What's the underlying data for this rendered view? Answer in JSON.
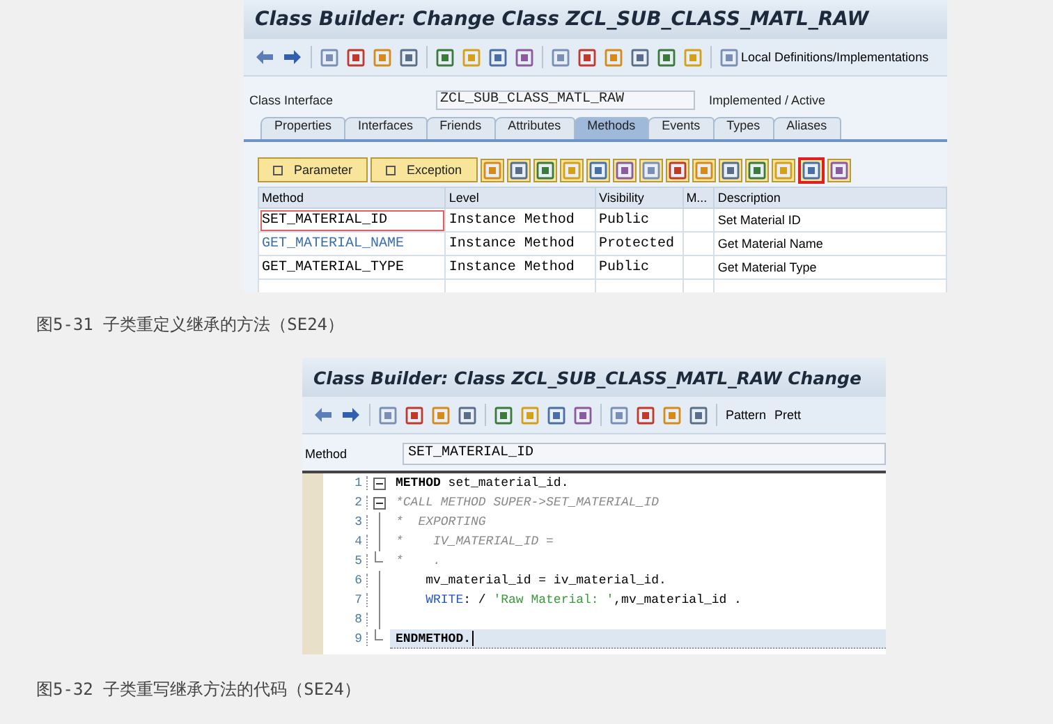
{
  "figures": [
    {
      "kind": "class_builder",
      "window_title": "Class Builder: Change Class ZCL_SUB_CLASS_MATL_RAW",
      "toolbar_link": "Local Definitions/Implementations",
      "class_interface": {
        "label": "Class Interface",
        "value": "ZCL_SUB_CLASS_MATL_RAW",
        "status": "Implemented / Active"
      },
      "tabs": [
        {
          "label": "Properties",
          "selected": false
        },
        {
          "label": "Interfaces",
          "selected": false
        },
        {
          "label": "Friends",
          "selected": false
        },
        {
          "label": "Attributes",
          "selected": false
        },
        {
          "label": "Methods",
          "selected": true
        },
        {
          "label": "Events",
          "selected": false
        },
        {
          "label": "Types",
          "selected": false
        },
        {
          "label": "Aliases",
          "selected": false
        }
      ],
      "method_buttons": [
        "Parameter",
        "Exception"
      ],
      "method_tools": [
        {
          "highlighted": false
        },
        {
          "highlighted": false
        },
        {
          "highlighted": false
        },
        {
          "highlighted": false
        },
        {
          "highlighted": false
        },
        {
          "highlighted": false
        },
        {
          "highlighted": false
        },
        {
          "highlighted": false
        },
        {
          "highlighted": false
        },
        {
          "highlighted": false
        },
        {
          "highlighted": false
        },
        {
          "highlighted": false
        },
        {
          "highlighted": true
        },
        {
          "highlighted": false
        }
      ],
      "columns": [
        "Method",
        "Level",
        "Visibility",
        "M...",
        "Description"
      ],
      "rows": [
        {
          "cells": [
            "SET_MATERIAL_ID",
            "Instance Method",
            "Public",
            "Set Material ID"
          ],
          "inherited": false,
          "focused": true
        },
        {
          "cells": [
            "GET_MATERIAL_NAME",
            "Instance Method",
            "Protected",
            "Get Material Name"
          ],
          "inherited": true,
          "focused": false
        },
        {
          "cells": [
            "GET_MATERIAL_TYPE",
            "Instance Method",
            "Public",
            "Get Material Type"
          ],
          "inherited": false,
          "focused": false
        }
      ],
      "caption": "图5-31 子类重定义继承的方法（SE24）"
    },
    {
      "kind": "code_editor",
      "window_title": "Class Builder: Class ZCL_SUB_CLASS_MATL_RAW Change",
      "toolbar_texts": [
        "Pattern",
        "Prett"
      ],
      "method_label": "Method",
      "method_value": "SET_MATERIAL_ID",
      "lines": [
        {
          "number": "1",
          "fold_toggle": true,
          "current": false,
          "segments": [
            {
              "text": "METHOD",
              "kind": "bold"
            },
            {
              "text": " set_material_id.",
              "kind": "plain"
            }
          ]
        },
        {
          "number": "2",
          "fold_toggle": true,
          "current": false,
          "segments": [
            {
              "text": "*CALL METHOD SUPER->SET_MATERIAL_ID",
              "kind": "comment"
            }
          ]
        },
        {
          "number": "3",
          "fold_toggle": false,
          "block_end": false,
          "current": false,
          "segments": [
            {
              "text": "*  EXPORTING",
              "kind": "comment"
            }
          ]
        },
        {
          "number": "4",
          "fold_toggle": false,
          "block_end": false,
          "current": false,
          "segments": [
            {
              "text": "*    IV_MATERIAL_ID =",
              "kind": "comment"
            }
          ]
        },
        {
          "number": "5",
          "fold_toggle": false,
          "block_end": true,
          "current": false,
          "segments": [
            {
              "text": "*    .",
              "kind": "comment"
            }
          ]
        },
        {
          "number": "6",
          "fold_toggle": false,
          "block_end": false,
          "current": false,
          "segments": [
            {
              "text": "    mv_material_id = iv_material_id.",
              "kind": "plain"
            }
          ]
        },
        {
          "number": "7",
          "fold_toggle": false,
          "block_end": false,
          "current": false,
          "segments": [
            {
              "text": "    WRITE",
              "kind": "keyword"
            },
            {
              "text": ": / ",
              "kind": "plain"
            },
            {
              "text": "'Raw Material: '",
              "kind": "string"
            },
            {
              "text": ",mv_material_id .",
              "kind": "plain"
            }
          ]
        },
        {
          "number": "8",
          "fold_toggle": false,
          "block_end": false,
          "current": false
        },
        {
          "number": "9",
          "fold_toggle": false,
          "block_end": true,
          "current": true,
          "segments": [
            {
              "text": "ENDMETHOD.",
              "kind": "bold"
            }
          ]
        }
      ],
      "caption": "图5-32 子类重写继承方法的代码（SE24）"
    }
  ]
}
